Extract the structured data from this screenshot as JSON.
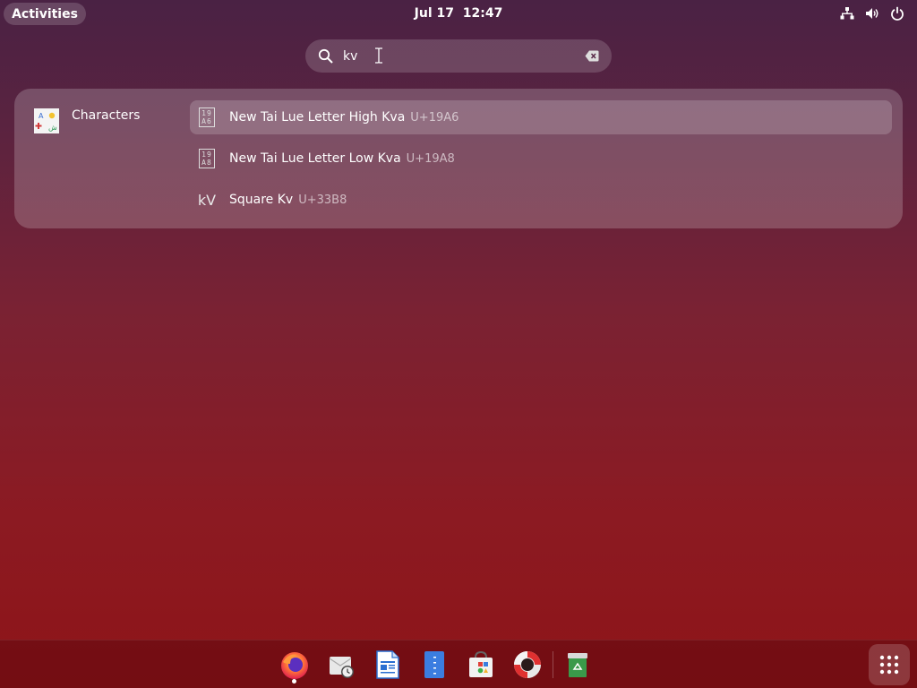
{
  "topbar": {
    "activities_label": "Activities",
    "clock": "Jul 17  12:47",
    "tray_icons": [
      "network-icon",
      "volume-icon",
      "power-icon"
    ]
  },
  "search": {
    "value": "kv"
  },
  "results": {
    "provider": {
      "name": "Characters",
      "icon": "characters-app-icon"
    },
    "items": [
      {
        "name": "New Tai Lue Letter High Kva",
        "code": "U+19A6",
        "glyph_top": "19",
        "glyph_bottom": "A6",
        "selected": true
      },
      {
        "name": "New Tai Lue Letter Low Kva",
        "code": "U+19A8",
        "glyph_top": "19",
        "glyph_bottom": "A8",
        "selected": false
      },
      {
        "name": "Square Kv",
        "code": "U+33B8",
        "glyph": "kV",
        "selected": false
      }
    ]
  },
  "dock": {
    "apps": [
      "firefox-icon",
      "mail-clock-icon",
      "writer-icon",
      "text-editor-icon",
      "software-store-icon",
      "help-icon",
      "trash-icon"
    ],
    "app_grid": "app-grid-icon",
    "colors": {
      "firefox": "#ff7139",
      "writer": "#2a6fd1",
      "trash": "#3a9a4a"
    }
  }
}
